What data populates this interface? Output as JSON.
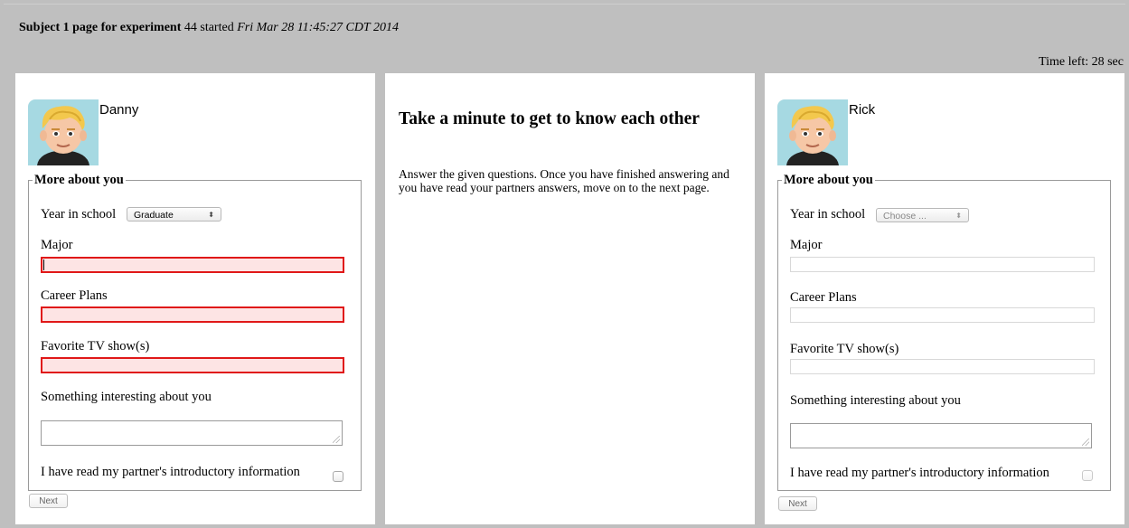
{
  "header": {
    "title_bold": "Subject 1 page for experiment",
    "title_mid": " 44 started ",
    "title_italic": "Fri Mar 28 11:45:27 CDT 2014",
    "timer": "Time left: 28 sec"
  },
  "left": {
    "name": "Danny",
    "legend": "More about you",
    "year_label": "Year in school",
    "year_value": "Graduate",
    "major_label": "Major",
    "major_value": "",
    "career_label": "Career Plans",
    "career_value": "",
    "tv_label": "Favorite TV show(s)",
    "tv_value": "",
    "interesting_label": "Something interesting about you",
    "interesting_value": "",
    "read_label": "I have read my partner's introductory information",
    "next_label": "Next"
  },
  "middle": {
    "title": "Take a minute to get to know each other",
    "body": "Answer the given questions. Once you have finished answering and you have read your partners answers, move on to the next page."
  },
  "right": {
    "name": "Rick",
    "legend": "More about you",
    "year_label": "Year in school",
    "year_value": "Choose ...",
    "major_label": "Major",
    "major_value": "",
    "career_label": "Career Plans",
    "career_value": "",
    "tv_label": "Favorite TV show(s)",
    "tv_value": "",
    "interesting_label": "Something interesting about you",
    "interesting_value": "",
    "read_label": "I have read my partner's introductory information",
    "next_label": "Next"
  },
  "colors": {
    "page_bg": "#bfbfbf",
    "error_border": "#e01818",
    "error_fill": "#fde4e4"
  },
  "icons": {
    "avatar": "cartoon-blond-boy-avatar",
    "select_arrows": "up-down-arrows-icon",
    "resize": "resize-grip-icon"
  }
}
